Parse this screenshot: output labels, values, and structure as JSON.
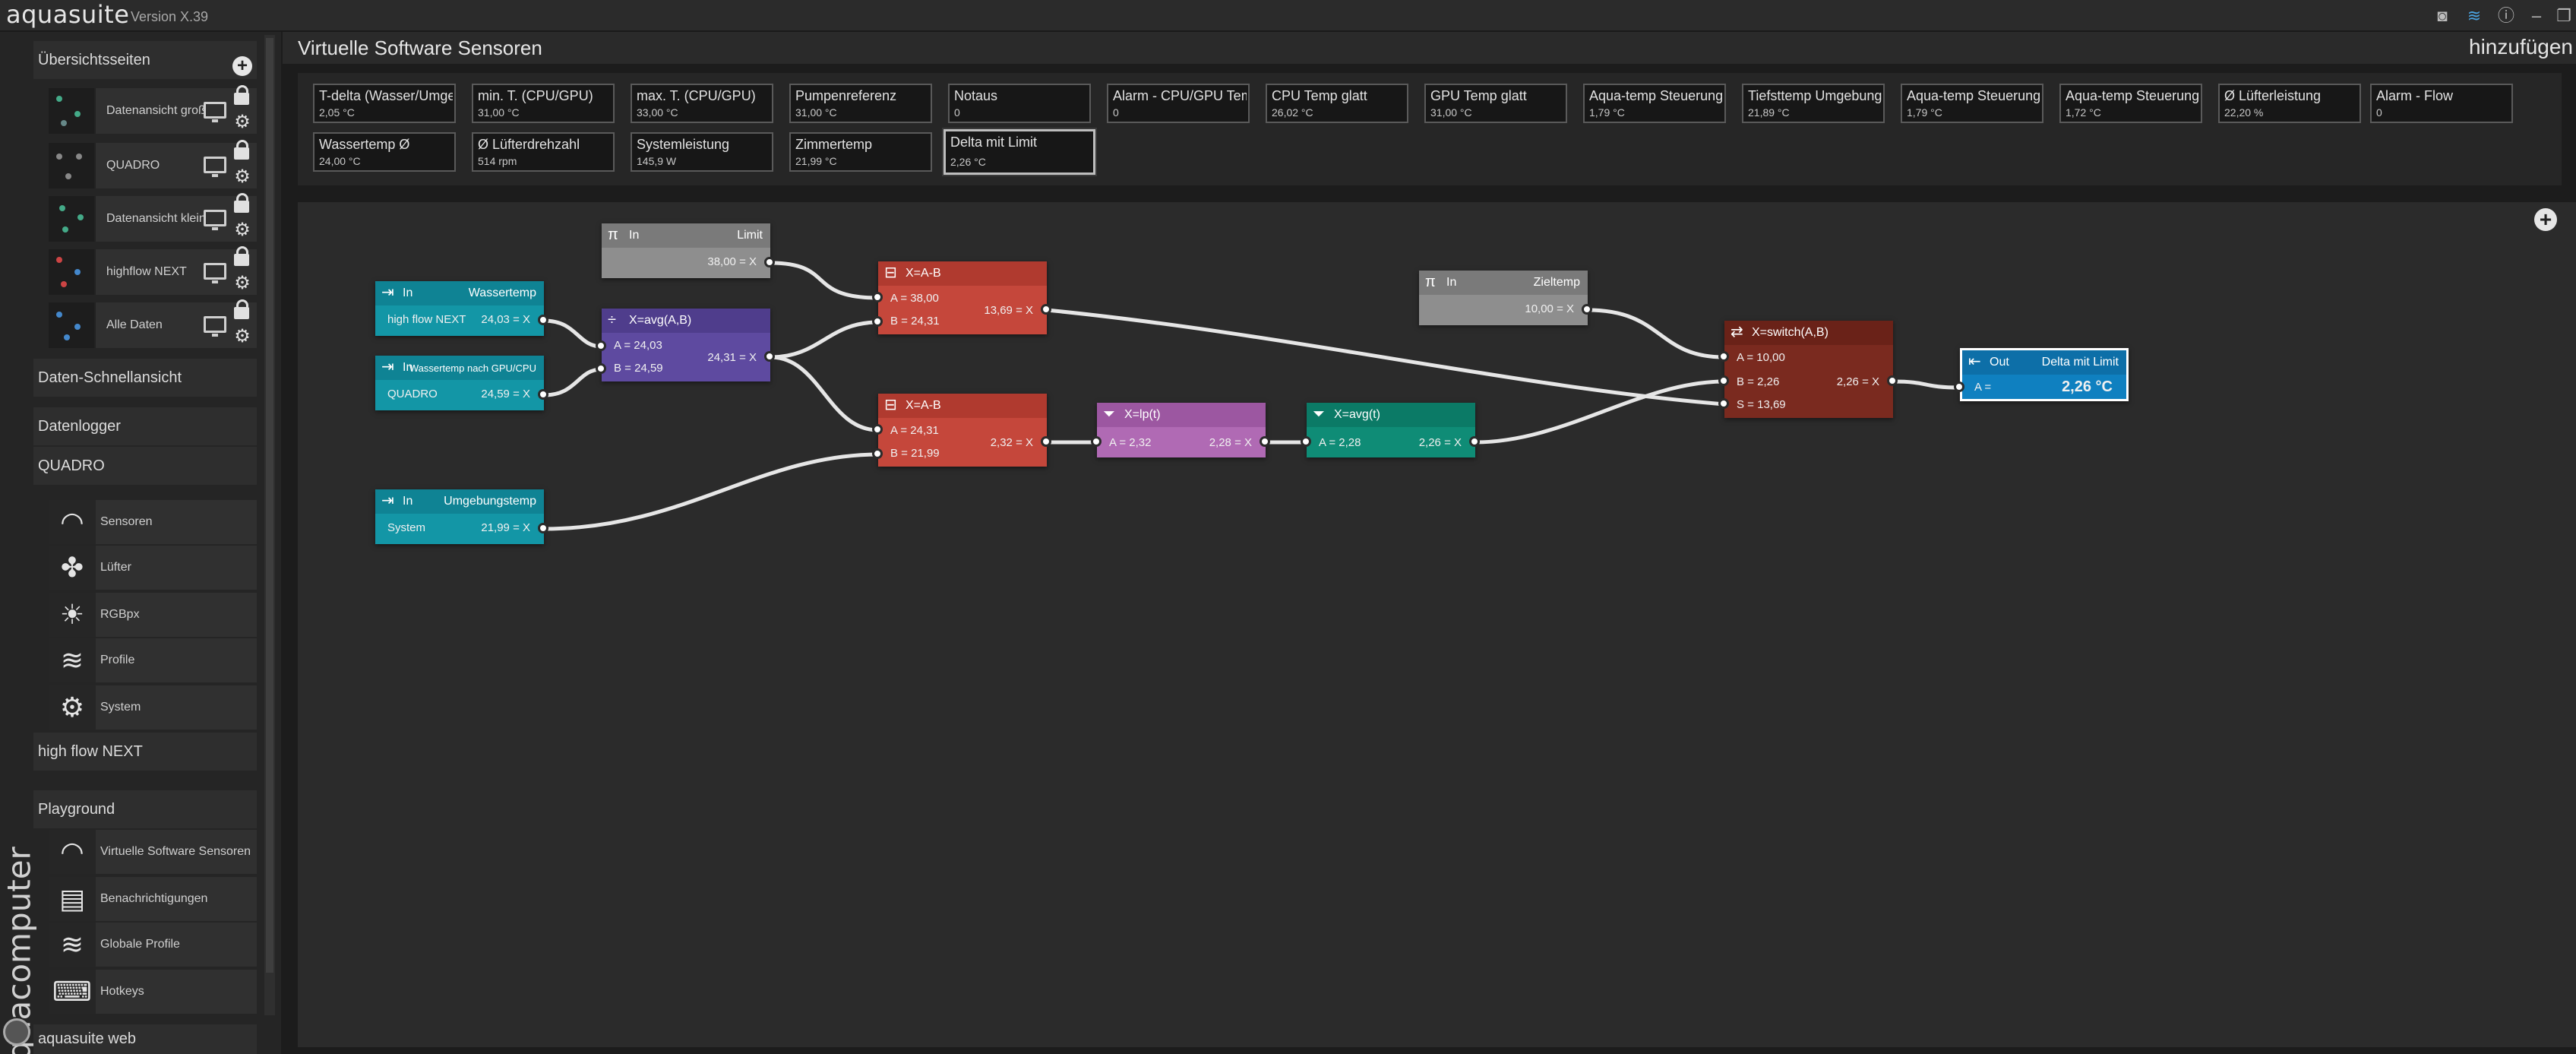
{
  "app": {
    "name": "aquasuite",
    "version": "Version X.39",
    "brand": "aquacomputer"
  },
  "sidebar": {
    "overview_header": "Übersichtsseiten",
    "overview_pages": [
      {
        "label": "Datenansicht groß"
      },
      {
        "label": "QUADRO"
      },
      {
        "label": "Datenansicht klein"
      },
      {
        "label": "highflow NEXT"
      },
      {
        "label": "Alle Daten"
      }
    ],
    "quick_view": "Daten-Schnellansicht",
    "datalogger": "Datenlogger",
    "device_quadro": "QUADRO",
    "quadro_items": [
      {
        "label": "Sensoren",
        "icon": "gauge-icon"
      },
      {
        "label": "Lüfter",
        "icon": "fan-icon"
      },
      {
        "label": "RGBpx",
        "icon": "bulb-icon"
      },
      {
        "label": "Profile",
        "icon": "layers-icon"
      },
      {
        "label": "System",
        "icon": "gear-icon"
      }
    ],
    "device_highflow": "high flow NEXT",
    "playground": "Playground",
    "playground_items": [
      {
        "label": "Virtuelle Software Sensoren",
        "icon": "gauge-icon"
      },
      {
        "label": "Benachrichtigungen",
        "icon": "message-icon"
      },
      {
        "label": "Globale Profile",
        "icon": "layers-icon"
      },
      {
        "label": "Hotkeys",
        "icon": "keyboard-icon"
      }
    ],
    "web": "aquasuite web"
  },
  "header": {
    "title": "Virtuelle Software Sensoren",
    "add": "hinzufügen"
  },
  "tiles": [
    {
      "name": "T-delta (Wasser/Umgebung)",
      "value": "2,05 °C"
    },
    {
      "name": "min. T. (CPU/GPU)",
      "value": "31,00 °C"
    },
    {
      "name": "max. T. (CPU/GPU)",
      "value": "33,00 °C"
    },
    {
      "name": "Pumpenreferenz",
      "value": "31,00 °C"
    },
    {
      "name": "Notaus",
      "value": "0"
    },
    {
      "name": "Alarm - CPU/GPU Temp",
      "value": "0"
    },
    {
      "name": "CPU Temp glatt",
      "value": "26,02 °C"
    },
    {
      "name": "GPU Temp glatt",
      "value": "31,00 °C"
    },
    {
      "name": "Aqua-temp Steuerung",
      "value": "1,79 °C"
    },
    {
      "name": "Tiefsttemp Umgebung",
      "value": "21,89 °C"
    },
    {
      "name": "Aqua-temp Steuerung",
      "value": "1,79 °C"
    },
    {
      "name": "Aqua-temp Steuerung",
      "value": "1,72 °C"
    },
    {
      "name": "Ø Lüfterleistung",
      "value": "22,20 %"
    },
    {
      "name": "Alarm - Flow",
      "value": "0"
    },
    {
      "name": "Wassertemp Ø",
      "value": "24,00 °C"
    },
    {
      "name": "Ø Lüfterdrehzahl",
      "value": "514 rpm"
    },
    {
      "name": "Systemleistung",
      "value": "145,9 W"
    },
    {
      "name": "Zimmertemp",
      "value": "21,99 °C"
    },
    {
      "name": "Delta mit Limit",
      "value": "2,26 °C"
    }
  ],
  "nodes": {
    "const_limit": {
      "h1": "In",
      "h2": "Limit",
      "r1": "38,00 = X"
    },
    "in_wasser": {
      "h1": "In",
      "h2": "Wassertemp",
      "r1l": "high flow NEXT",
      "r1r": "24,03 = X"
    },
    "in_gpu": {
      "h1": "In",
      "h2": "Wassertemp nach GPU/CPU",
      "r1l": "QUADRO",
      "r1r": "24,59 = X"
    },
    "avg": {
      "h1": "X=avg(A,B)",
      "a": "A = 24,03",
      "b": "B = 24,59",
      "out": "24,31 = X"
    },
    "sub1": {
      "h1": "X=A-B",
      "a": "A = 38,00",
      "b": "B = 24,31",
      "out": "13,69 = X"
    },
    "sub2": {
      "h1": "X=A-B",
      "a": "A = 24,31",
      "b": "B = 21,99",
      "out": "2,32 = X"
    },
    "lp": {
      "h1": "X=lp(t)",
      "a": "A = 2,32",
      "out": "2,28 = X"
    },
    "avgt": {
      "h1": "X=avg(t)",
      "a": "A = 2,28",
      "out": "2,26 = X"
    },
    "const_ziel": {
      "h1": "In",
      "h2": "Zieltemp",
      "r1": "10,00 = X"
    },
    "switch": {
      "h1": "X=switch(A,B)",
      "a": "A = 10,00",
      "b": "B = 2,26",
      "s": "S = 13,69",
      "out": "2,26 = X"
    },
    "out": {
      "h1": "Out",
      "h2": "Delta mit Limit",
      "a": "A =",
      "val": "2,26 °C"
    },
    "in_umg": {
      "h1": "In",
      "h2": "Umgebungstemp",
      "r1l": "System",
      "r1r": "21,99 = X"
    }
  }
}
